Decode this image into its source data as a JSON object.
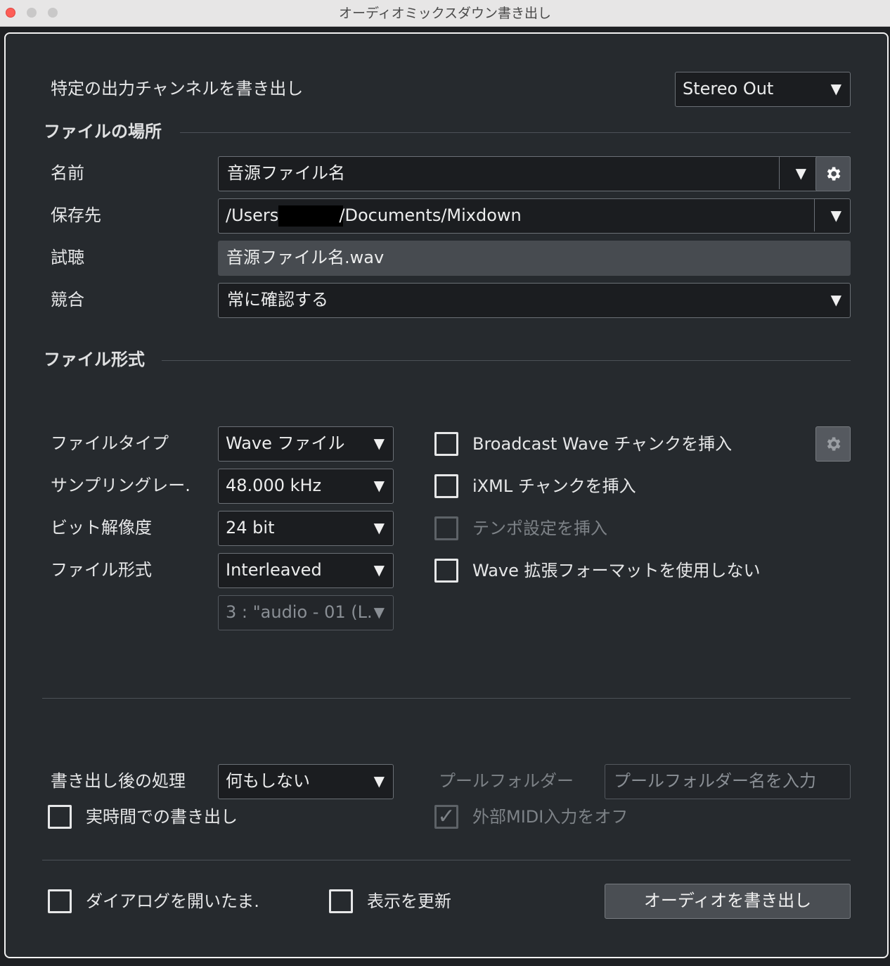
{
  "window": {
    "title": "オーディオミックスダウン書き出し"
  },
  "top": {
    "label": "特定の出力チャンネルを書き出し",
    "output_channel": "Stereo Out"
  },
  "file_location": {
    "section_title": "ファイルの場所",
    "name_label": "名前",
    "name_value": "音源ファイル名",
    "path_label": "保存先",
    "path_value_prefix": "/Users/",
    "path_value_suffix": "/Documents/Mixdown",
    "preview_label": "試聴",
    "preview_value": "音源ファイル名.wav",
    "conflict_label": "競合",
    "conflict_value": "常に確認する"
  },
  "file_format": {
    "section_title": "ファイル形式",
    "filetype_label": "ファイルタイプ",
    "filetype_value": "Wave ファイル",
    "samplerate_label": "サンプリングレー.",
    "samplerate_value": "48.000 kHz",
    "bitdepth_label": "ビット解像度",
    "bitdepth_value": "24 bit",
    "format_label": "ファイル形式",
    "format_value": "Interleaved",
    "channel_value": "3 : \"audio - 01 (L.",
    "options": [
      {
        "label": "Broadcast Wave チャンクを挿入",
        "checked": false,
        "enabled": true
      },
      {
        "label": "iXML チャンクを挿入",
        "checked": false,
        "enabled": true
      },
      {
        "label": "テンポ設定を挿入",
        "checked": false,
        "enabled": false
      },
      {
        "label": "Wave 拡張フォーマットを使用しない",
        "checked": false,
        "enabled": true
      }
    ]
  },
  "post": {
    "post_label": "書き出し後の処理",
    "post_value": "何もしない",
    "pool_folder_label": "プールフォルダー",
    "pool_folder_placeholder": "プールフォルダー名を入力",
    "realtime_label": "実時間での書き出し",
    "realtime_checked": false,
    "midi_off_label": "外部MIDI入力をオフ",
    "midi_off_checked": true
  },
  "footer": {
    "keep_open_label": "ダイアログを開いたま.",
    "keep_open_checked": false,
    "refresh_label": "表示を更新",
    "refresh_checked": false,
    "export_button": "オーディオを書き出し"
  },
  "icons": {
    "dropdown": "▼",
    "gear": "gear-icon",
    "check": "✓"
  },
  "colors": {
    "background": "#262a2e",
    "field": "#1b1d20",
    "readonly_field": "#474b50",
    "close": "#fd5e57",
    "inactive_light": "#c9c8c8"
  }
}
